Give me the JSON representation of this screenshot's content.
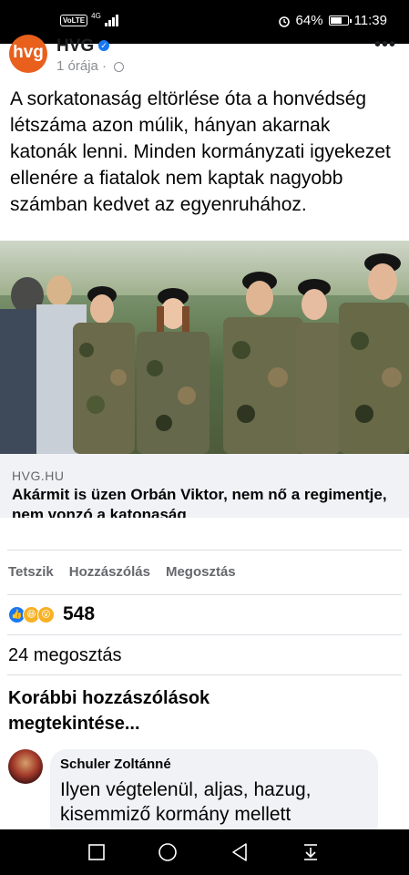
{
  "status_bar": {
    "volte": "VoLTE",
    "network": "4G",
    "battery": "64%",
    "battery_level": 0.64,
    "time": "11:39",
    "icons": [
      "alarm-icon",
      "battery-icon",
      "signal-icon"
    ]
  },
  "post": {
    "avatar_text": "hvg",
    "page_name": "HVG",
    "time": "1 órája",
    "text": "A sorkatonaság eltörlése óta a honvédség létszáma azon múlik, hányan akarnak katonák lenni. Minden kormányzati igyekezet ellenére a fiatalok nem kaptak nagyobb számban kedvet az egyenruhához.",
    "image_semantic": "photo-young-soldiers-in-camouflage-and-berets"
  },
  "link_preview": {
    "domain": "HVG.HU",
    "title": "Akármit is üzen Orbán Viktor, nem nő a regimentje, nem vonzó a katonaság"
  },
  "actions": {
    "like": "Tetszik",
    "comment": "Hozzászólás",
    "share": "Megosztás"
  },
  "reactions": {
    "types": [
      "like-icon",
      "haha-icon",
      "wow-icon"
    ],
    "count": "548"
  },
  "shares": "24 megosztás",
  "previous_comments": "Korábbi hozzászólások megtekintése...",
  "comment": {
    "author": "Schuler Zoltánné",
    "text": "Ilyen végtelenül, aljas, hazug, kisemmiző kormány mellett"
  },
  "nav": {
    "buttons": [
      "recent-apps-icon",
      "home-icon",
      "back-icon",
      "notification-shade-icon"
    ]
  },
  "colors": {
    "brand": "#e8601c",
    "link_blue": "#1877f2",
    "muted": "#65676b"
  }
}
